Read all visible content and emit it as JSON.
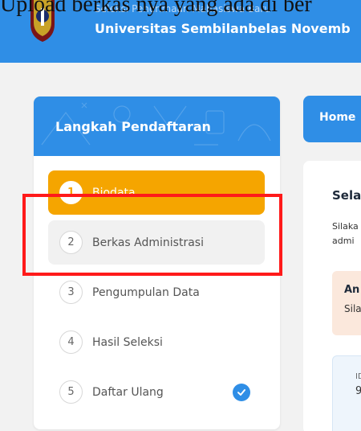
{
  "caption": "Upload berkas nya yang ada di ber",
  "header": {
    "subtitle": "Seleksi Penerimaan Mahasiswa Baru",
    "university": "Universitas Sembilanbelas Novemb"
  },
  "sidebar": {
    "title": "Langkah Pendaftaran",
    "steps": [
      {
        "num": "1",
        "label": "Biodata",
        "state": "active"
      },
      {
        "num": "2",
        "label": "Berkas Administrasi",
        "state": "hover"
      },
      {
        "num": "3",
        "label": "Pengumpulan Data",
        "state": "default"
      },
      {
        "num": "4",
        "label": "Hasil Seleksi",
        "state": "default"
      },
      {
        "num": "5",
        "label": "Daftar Ulang",
        "state": "default",
        "icon": "check-circle-icon"
      }
    ]
  },
  "breadcrumb": {
    "home": "Home"
  },
  "content": {
    "title": "Sela",
    "desc_line1": "Silaka",
    "desc_line2": "admi",
    "alert_title": "An",
    "alert_body": "Sila",
    "id_label": "ID",
    "id_value": "9"
  },
  "colors": {
    "primary": "#2f8ee6",
    "active": "#f5a500",
    "highlight": "#ff1a1a"
  }
}
